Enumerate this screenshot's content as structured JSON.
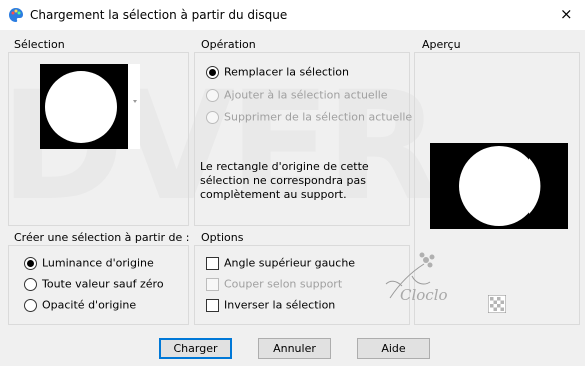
{
  "window": {
    "title": "Chargement la sélection à partir du disque",
    "close_glyph": "×",
    "icon": "paint-palette-icon"
  },
  "watermark": {
    "text": "DVER"
  },
  "selection_group": {
    "title": "Sélection",
    "thumbnail": "selection-thumbnail"
  },
  "operation_group": {
    "title": "Opération",
    "options": [
      {
        "label": "Remplacer la sélection",
        "checked": true,
        "enabled": true
      },
      {
        "label": "Ajouter à la sélection actuelle",
        "checked": false,
        "enabled": false
      },
      {
        "label": "Supprimer de la sélection actuelle",
        "checked": false,
        "enabled": false
      }
    ],
    "note": "Le rectangle d'origine de cette sélection ne correspondra pas complètement au support."
  },
  "preview_group": {
    "title": "Aperçu"
  },
  "create_group": {
    "title": "Créer une sélection à partir de :",
    "options": [
      {
        "label": "Luminance d'origine",
        "checked": true
      },
      {
        "label": "Toute valeur sauf zéro",
        "checked": false
      },
      {
        "label": "Opacité d'origine",
        "checked": false
      }
    ]
  },
  "options_group": {
    "title": "Options",
    "checks": [
      {
        "label": "Angle supérieur gauche",
        "checked": false,
        "enabled": true
      },
      {
        "label": "Couper selon support",
        "checked": false,
        "enabled": false
      },
      {
        "label": "Inverser la sélection",
        "checked": false,
        "enabled": true
      }
    ]
  },
  "signature": {
    "text": "Cloclo"
  },
  "buttons": {
    "load": "Charger",
    "cancel": "Annuler",
    "help": "Aide"
  }
}
